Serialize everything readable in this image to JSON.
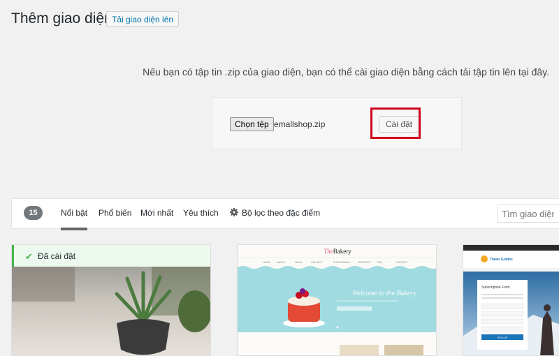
{
  "header": {
    "title": "Thêm giao diện",
    "upload_button": "Tải giao diện lên"
  },
  "upload": {
    "help_text": "Nếu bạn có tập tin .zip của giao diện, bạn có thể cài giao diện bằng cách tải tập tin lên tại đây.",
    "choose_button": "Chọn tệp",
    "file_name": "emallshop.zip",
    "install_button": "Cài đặt"
  },
  "filter": {
    "count": "15",
    "tabs": [
      "Nổi bật",
      "Phổ biến",
      "Mới nhất",
      "Yêu thích"
    ],
    "feature_filter": "Bộ lọc theo đặc điểm",
    "search_placeholder": "Tìm giao diện..."
  },
  "themes": [
    {
      "installed_label": "Đã cài đặt"
    },
    {
      "logo_prefix": "The",
      "logo": "Bakery",
      "welcome": "Welcome to the Bakery",
      "menu": [
        "HOME",
        "ABOUT",
        "MENU",
        "GALLERY",
        "TESTIMONIALS",
        "SERVICES",
        "FAQ",
        "CONTACT"
      ]
    },
    {
      "brand": "Travel Guides",
      "form_title": "Subscription Form",
      "submit": "SIGN UP"
    }
  ],
  "colors": {
    "highlight": "#d0021b",
    "link": "#0073aa",
    "installed": "#46b450"
  }
}
